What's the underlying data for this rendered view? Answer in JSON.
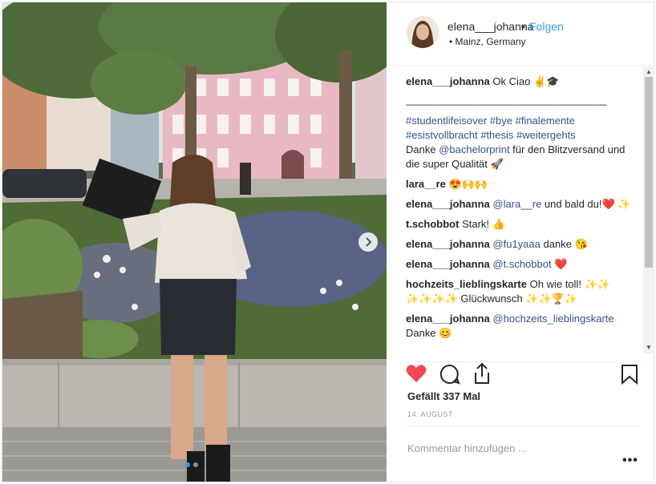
{
  "post": {
    "username": "elena___johanna",
    "separator": "•",
    "follow_label": "Folgen",
    "location": "• Mainz, Germany"
  },
  "comments": [
    {
      "user": "elena___johanna",
      "text": "Ok Ciao ✌️🎓"
    },
    {
      "user": "",
      "text": "________________________________________"
    },
    {
      "user": "",
      "text": "#studentlifeisover #bye #finalemente #esistvollbracht #thesis #weitergehts"
    },
    {
      "user": "",
      "text_pre": "Danke ",
      "mention": "@bachelorprint",
      "text_post": " für den Blitzversand und die super Qualität 🚀"
    },
    {
      "user": "lara__re",
      "text": "😍🙌🙌"
    },
    {
      "user": "elena___johanna",
      "mention": "@lara__re",
      "text_post": " und bald du!❤️ ✨"
    },
    {
      "user": "t.schobbot",
      "text": "Stark! 👍"
    },
    {
      "user": "elena___johanna",
      "mention": "@fu1yaaa",
      "text_post": " danke 😘"
    },
    {
      "user": "elena___johanna",
      "mention": "@t.schobbot",
      "text_post": " ❤️"
    },
    {
      "user": "hochzeits_lieblingskarte",
      "text": "Oh wie toll! ✨✨ ✨✨✨✨ Glückwunsch ✨✨🏆✨"
    },
    {
      "user": "elena___johanna",
      "mention": "@hochzeits_lieblingskarte",
      "text_post": " Danke 😊"
    }
  ],
  "likes": "Gefällt 337 Mal",
  "date": "14. AUGUST",
  "add_comment_placeholder": "Kommentar hinzufügen ...",
  "more_label": "•••",
  "icons": {
    "like": "heart-icon",
    "comment": "comment-icon",
    "share": "share-icon",
    "save": "bookmark-icon",
    "next": "chevron-right-icon"
  },
  "colors": {
    "like": "#ed4956",
    "link": "#385185",
    "follow": "#3897f0"
  },
  "carousel": {
    "count": 2,
    "active": 1
  }
}
